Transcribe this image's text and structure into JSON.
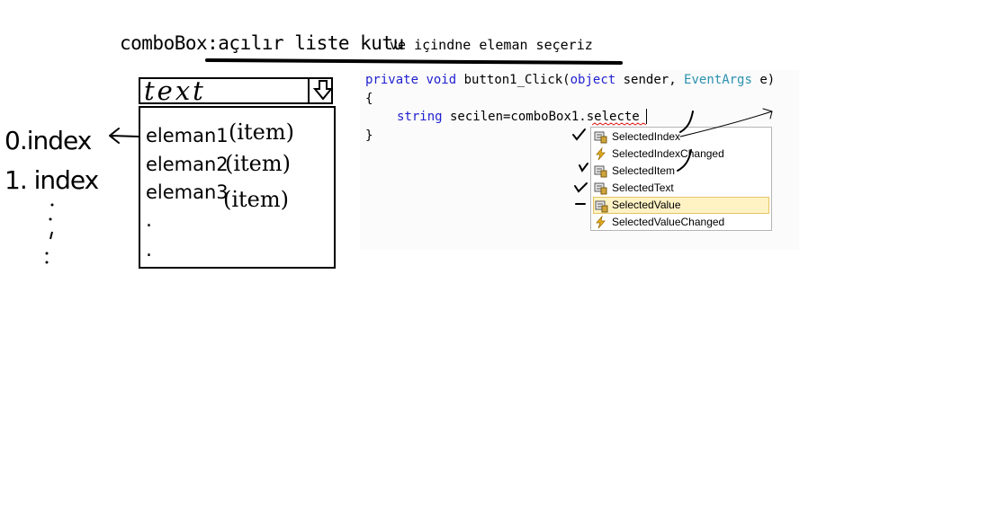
{
  "title": {
    "main": "comboBox:açılır liste kutu",
    "sub": "ve içindne eleman seçeriz"
  },
  "combobox": {
    "text": "text",
    "icon": "down-arrow-icon",
    "items": [
      {
        "label": "eleman1",
        "note": "(item)"
      },
      {
        "label": "eleman2",
        "note": "(item)"
      },
      {
        "label": "eleman3",
        "note": "(item)"
      }
    ],
    "dots": [
      ".",
      "."
    ]
  },
  "indexes": {
    "first": "0.index",
    "second": "1. index"
  },
  "code": {
    "line1_kw1": "private",
    "line1_kw2": "void",
    "line1_name": " button1_Click(",
    "line1_kw3": "object",
    "line1_mid": " sender, ",
    "line1_type": "EventArgs",
    "line1_end": " e)",
    "open_brace": "{",
    "line2_kw": "string",
    "line2_rest": " secilen=comboBox1.",
    "line2_typed": "selecte",
    "close_brace": "}"
  },
  "intellisense": {
    "items": [
      {
        "label": "SelectedIndex",
        "icon": "property-icon"
      },
      {
        "label": "SelectedIndexChanged",
        "icon": "event-icon"
      },
      {
        "label": "SelectedItem",
        "icon": "property-icon"
      },
      {
        "label": "SelectedText",
        "icon": "property-icon"
      },
      {
        "label": "SelectedValue",
        "icon": "property-icon",
        "selected": true
      },
      {
        "label": "SelectedValueChanged",
        "icon": "event-icon"
      }
    ]
  },
  "colors": {
    "keyword": "#1f1fd0",
    "type": "#2b91af",
    "selection_bg": "#fff3c4",
    "selection_border": "#e5c365",
    "squiggle": "#e02020"
  }
}
